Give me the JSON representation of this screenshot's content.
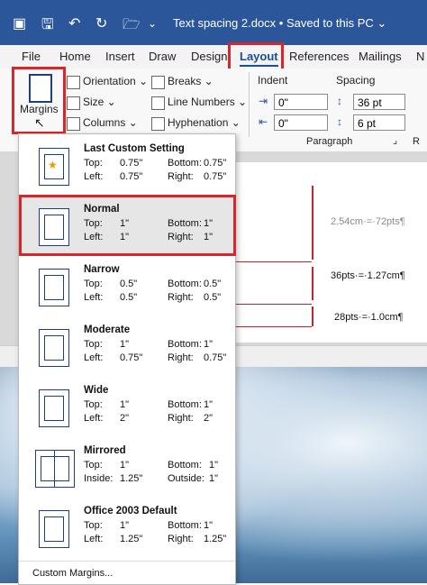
{
  "titlebar": {
    "title": "Text spacing 2.docx  •  Saved to this PC ⌄"
  },
  "tabs": [
    "File",
    "Home",
    "Insert",
    "Draw",
    "Design",
    "Layout",
    "References",
    "Mailings",
    "N"
  ],
  "ribbon": {
    "margins_label": "Margins",
    "orientation": "Orientation ⌄",
    "size": "Size ⌄",
    "columns": "Columns ⌄",
    "breaks": "Breaks ⌄",
    "line_numbers": "Line Numbers ⌄",
    "hyphenation": "Hyphenation ⌄",
    "indent": "Indent",
    "spacing": "Spacing",
    "indent_left": "0\"",
    "indent_right": "0\"",
    "spacing_before": "36 pt",
    "spacing_after": "6 pt",
    "paragraph": "Paragraph",
    "launcher": "⌟"
  },
  "menu": {
    "items": [
      {
        "name": "Last Custom Setting",
        "r1": [
          "Top:",
          "0.75\"",
          "Bottom:",
          "0.75\""
        ],
        "r2": [
          "Left:",
          "0.75\"",
          "Right:",
          "0.75\""
        ]
      },
      {
        "name": "Normal",
        "r1": [
          "Top:",
          "1\"",
          "Bottom:",
          "1\""
        ],
        "r2": [
          "Left:",
          "1\"",
          "Right:",
          "1\""
        ]
      },
      {
        "name": "Narrow",
        "r1": [
          "Top:",
          "0.5\"",
          "Bottom:",
          "0.5\""
        ],
        "r2": [
          "Left:",
          "0.5\"",
          "Right:",
          "0.5\""
        ]
      },
      {
        "name": "Moderate",
        "r1": [
          "Top:",
          "1\"",
          "Bottom:",
          "1\""
        ],
        "r2": [
          "Left:",
          "0.75\"",
          "Right:",
          "0.75\""
        ]
      },
      {
        "name": "Wide",
        "r1": [
          "Top:",
          "1\"",
          "Bottom:",
          "1\""
        ],
        "r2": [
          "Left:",
          "2\"",
          "Right:",
          "2\""
        ]
      },
      {
        "name": "Mirrored",
        "r1": [
          "Top:",
          "1\"",
          "Bottom:",
          "1\""
        ],
        "r2": [
          "Inside:",
          "1.25\"",
          "Outside:",
          "1\""
        ]
      },
      {
        "name": "Office 2003 Default",
        "r1": [
          "Top:",
          "1\"",
          "Bottom:",
          "1\""
        ],
        "r2": [
          "Left:",
          "1.25\"",
          "Right:",
          "1.25\""
        ]
      }
    ],
    "custom": "Custom Margins..."
  },
  "document": {
    "note1": "2.54cm·=·72pts¶",
    "note2": "36pts·=·1.27cm¶",
    "note3": "28pts·=·1.0cm¶"
  },
  "colors": {
    "titlebar": "#2b579a",
    "highlight": "#d9262b",
    "arrow": "#c0272d"
  }
}
